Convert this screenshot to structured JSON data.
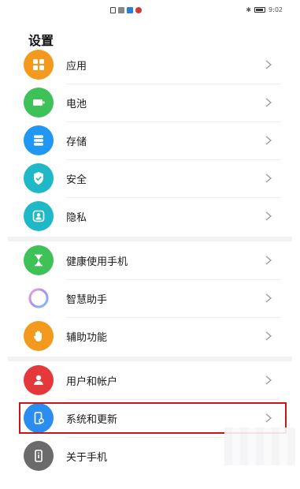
{
  "status_bar": {
    "time": "9:02",
    "bluetooth_icon": "bluetooth-icon"
  },
  "page": {
    "title": "设置"
  },
  "colors": {
    "apps": "#f39a1e",
    "battery": "#3ec157",
    "storage": "#2196f3",
    "security": "#1fb8c7",
    "privacy": "#1fb8c7",
    "health": "#3ec157",
    "assistant": "#b49df0",
    "accessibility": "#f39a1e",
    "accounts": "#e5383b",
    "system": "#2a8ef0",
    "about": "#6b6b6b",
    "highlight": "#c8151b"
  },
  "groups": [
    {
      "items": [
        {
          "label": "应用",
          "icon": "apps-grid-icon"
        },
        {
          "label": "电池",
          "icon": "battery-icon"
        },
        {
          "label": "存储",
          "icon": "storage-icon"
        },
        {
          "label": "安全",
          "icon": "shield-check-icon"
        },
        {
          "label": "隐私",
          "icon": "privacy-icon"
        }
      ]
    },
    {
      "items": [
        {
          "label": "健康使用手机",
          "icon": "hourglass-icon"
        },
        {
          "label": "智慧助手",
          "icon": "assistant-ring-icon"
        },
        {
          "label": "辅助功能",
          "icon": "hand-icon"
        }
      ]
    },
    {
      "items": [
        {
          "label": "用户和帐户",
          "icon": "user-icon"
        },
        {
          "label": "系统和更新",
          "icon": "system-update-icon"
        },
        {
          "label": "关于手机",
          "icon": "phone-info-icon"
        }
      ]
    }
  ],
  "chevron_icon": "chevron-right-icon"
}
